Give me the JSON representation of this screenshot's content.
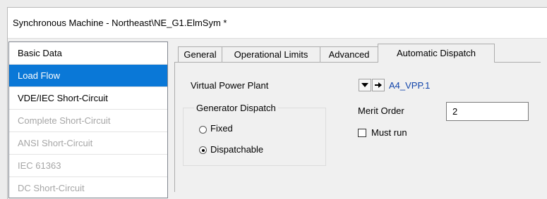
{
  "window": {
    "title": "Synchronous Machine - Northeast\\NE_G1.ElmSym *"
  },
  "sidebar": {
    "items": [
      {
        "label": "Basic Data",
        "state": "normal"
      },
      {
        "label": "Load Flow",
        "state": "selected"
      },
      {
        "label": "VDE/IEC Short-Circuit",
        "state": "normal"
      },
      {
        "label": "Complete Short-Circuit",
        "state": "disabled"
      },
      {
        "label": "ANSI Short-Circuit",
        "state": "disabled"
      },
      {
        "label": "IEC 61363",
        "state": "disabled"
      },
      {
        "label": "DC Short-Circuit",
        "state": "disabled"
      }
    ]
  },
  "tabs": [
    {
      "label": "General"
    },
    {
      "label": "Operational Limits"
    },
    {
      "label": "Advanced"
    },
    {
      "label": "Automatic Dispatch",
      "active": true
    }
  ],
  "dispatch": {
    "vpp_label": "Virtual Power Plant",
    "vpp_value": "A4_VPP.1",
    "group_title": "Generator Dispatch",
    "radio_fixed": "Fixed",
    "radio_dispatchable": "Dispatchable",
    "selected_radio": "Dispatchable",
    "merit_label": "Merit Order",
    "merit_value": "2",
    "must_run_label": "Must run",
    "must_run_checked": false
  },
  "colors": {
    "selection": "#0a78d7",
    "link": "#1144aa"
  }
}
